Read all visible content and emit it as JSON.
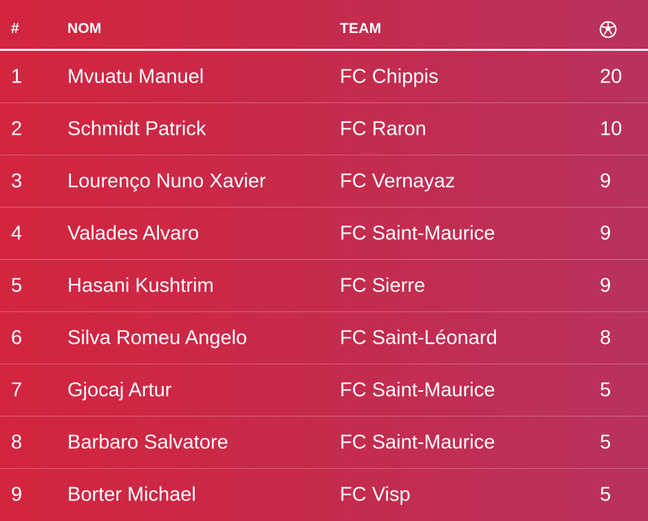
{
  "table": {
    "headers": {
      "rank": "#",
      "name": "NOM",
      "team": "TEAM",
      "goals_icon": "soccer-ball-icon"
    },
    "rows": [
      {
        "rank": "1",
        "name": "Mvuatu Manuel",
        "team": "FC Chippis",
        "goals": "20"
      },
      {
        "rank": "2",
        "name": "Schmidt Patrick",
        "team": "FC Raron",
        "goals": "10"
      },
      {
        "rank": "3",
        "name": "Lourenço Nuno Xavier",
        "team": "FC Vernayaz",
        "goals": "9"
      },
      {
        "rank": "4",
        "name": "Valades Alvaro",
        "team": "FC Saint-Maurice",
        "goals": "9"
      },
      {
        "rank": "5",
        "name": "Hasani Kushtrim",
        "team": "FC Sierre",
        "goals": "9"
      },
      {
        "rank": "6",
        "name": "Silva Romeu Angelo",
        "team": "FC Saint-Léonard",
        "goals": "8"
      },
      {
        "rank": "7",
        "name": "Gjocaj Artur",
        "team": "FC Saint-Maurice",
        "goals": "5"
      },
      {
        "rank": "8",
        "name": "Barbaro Salvatore",
        "team": "FC Saint-Maurice",
        "goals": "5"
      },
      {
        "rank": "9",
        "name": "Borter Michael",
        "team": "FC Visp",
        "goals": "5"
      }
    ]
  },
  "colors": {
    "gradient_start": "#d3253f",
    "gradient_end": "#b8325d",
    "text": "#ffffff"
  }
}
